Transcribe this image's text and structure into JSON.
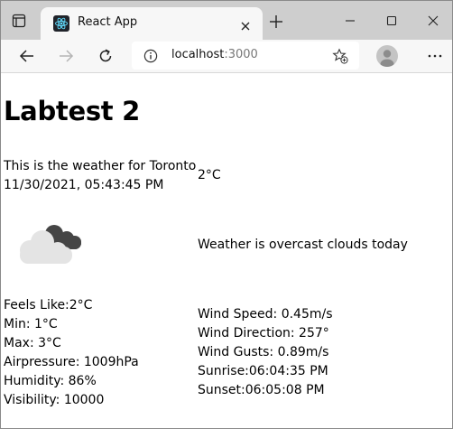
{
  "browser": {
    "tab": {
      "title": "React App"
    },
    "address": {
      "host": "localhost",
      "port": ":3000"
    }
  },
  "page": {
    "title": "Labtest 2",
    "city_line": "This is the weather for Toronto",
    "date_line": "11/30/2021, 05:43:45 PM",
    "temperature": "2°C",
    "weather_icon": "overcast-clouds-icon",
    "description": "Weather is overcast clouds today",
    "details_left": {
      "feels_like": "Feels Like:2°C",
      "min": "Min: 1°C",
      "max": "Max: 3°C",
      "air_pressure": "Airpressure: 1009hPa",
      "humidity": "Humidity: 86%",
      "visibility": "Visibility: 10000"
    },
    "details_right": {
      "wind_speed": "Wind Speed: 0.45m/s",
      "wind_direction": "Wind Direction: 257°",
      "wind_gusts": "Wind Gusts: 0.89m/s",
      "sunrise": "Sunrise:06:04:35 PM",
      "sunset": "Sunset:06:05:08 PM"
    }
  },
  "colors": {
    "titlebar": "#cecece",
    "toolbar": "#f7f7f7",
    "cloud_light": "#e4e4e4",
    "cloud_dark": "#454545",
    "react_logo": "#61dafb"
  }
}
